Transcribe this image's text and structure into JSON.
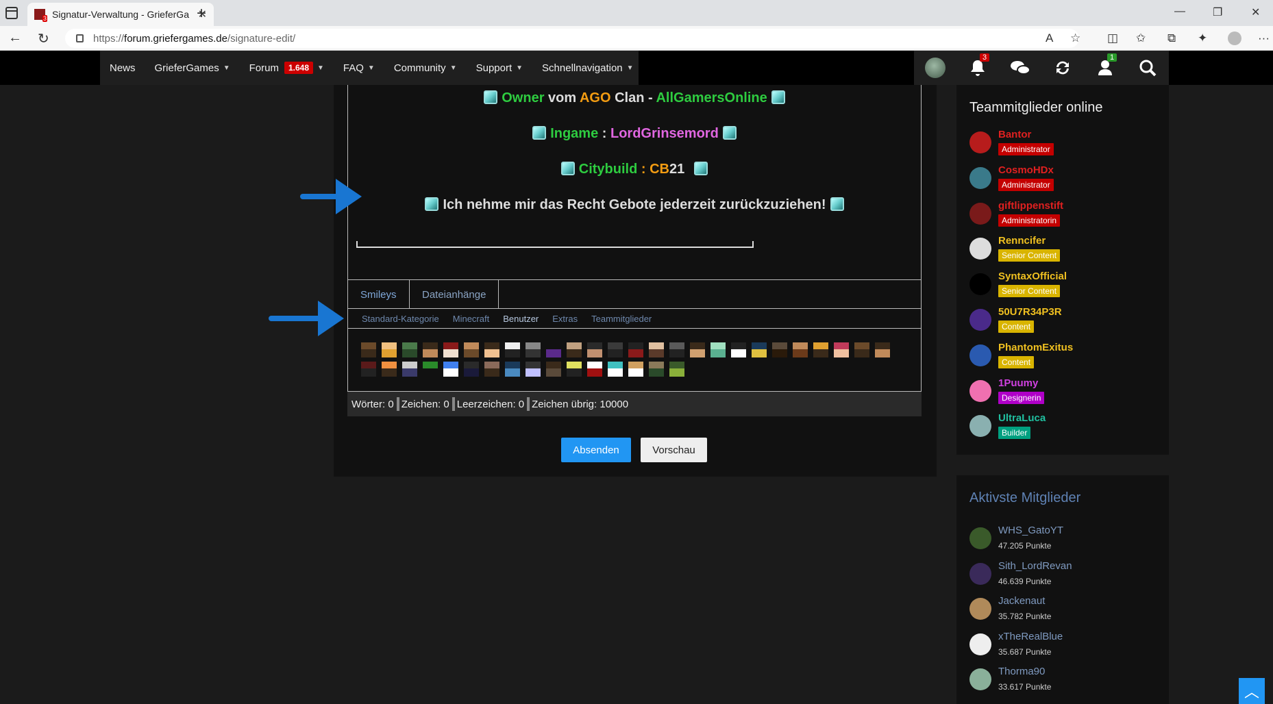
{
  "browser": {
    "tab_title": "Signatur-Verwaltung - GrieferGa",
    "url_protocol": "https://",
    "url_host": "forum.griefergames.de",
    "url_path": "/signature-edit/"
  },
  "nav": {
    "items": [
      {
        "label": "News",
        "has_chevron": false
      },
      {
        "label": "GrieferGames",
        "has_chevron": true
      },
      {
        "label": "Forum",
        "has_chevron": true,
        "badge": "1.648"
      },
      {
        "label": "FAQ",
        "has_chevron": true
      },
      {
        "label": "Community",
        "has_chevron": true
      },
      {
        "label": "Support",
        "has_chevron": true
      },
      {
        "label": "Schnellnavigation",
        "has_chevron": true
      }
    ],
    "notifications_count": "3",
    "friend_requests_count": "1"
  },
  "signature": {
    "line1": {
      "prefix_green": "Owner",
      "mid1": " vom ",
      "orange": "AGO",
      "mid2": " Clan - ",
      "green2": "AllGamersOnline"
    },
    "line2": {
      "green": "Ingame",
      "mid": " : ",
      "magenta": "LordGrinsemord"
    },
    "line3": {
      "green": "Citybuild",
      "mid": " : ",
      "orange": "CB",
      "white": "21"
    },
    "line4": "Ich nehme mir das Recht Gebote jederzeit zurückzuziehen!"
  },
  "editor": {
    "tabs": [
      "Smileys",
      "Dateianhänge"
    ],
    "categories": [
      "Standard-Kategorie",
      "Minecraft",
      "Benutzer",
      "Extras",
      "Teammitglieder"
    ],
    "selected_category": "Benutzer",
    "stats": {
      "words": "Wörter: 0",
      "chars": "Zeichen: 0",
      "spaces": "Leerzeichen: 0",
      "remaining": "Zeichen übrig: 10000"
    },
    "submit_label": "Absenden",
    "preview_label": "Vorschau"
  },
  "sidebar": {
    "team_title": "Teammitglieder online",
    "team": [
      {
        "name": "Bantor",
        "rank": "Administrator",
        "name_color": "#e02020",
        "rank_color": "#c40000"
      },
      {
        "name": "CosmoHDx",
        "rank": "Administrator",
        "name_color": "#e02020",
        "rank_color": "#c40000"
      },
      {
        "name": "giftlippenstift",
        "rank": "Administratorin",
        "name_color": "#e02020",
        "rank_color": "#c40000"
      },
      {
        "name": "Renncifer",
        "rank": "Senior Content",
        "name_color": "#f0c020",
        "rank_color": "#d9b400"
      },
      {
        "name": "SyntaxOfficial",
        "rank": "Senior Content",
        "name_color": "#f0c020",
        "rank_color": "#d9b400"
      },
      {
        "name": "50U7R34P3R",
        "rank": "Content",
        "name_color": "#f0c020",
        "rank_color": "#d9b400"
      },
      {
        "name": "PhantomExitus",
        "rank": "Content",
        "name_color": "#f0c020",
        "rank_color": "#d9b400"
      },
      {
        "name": "1Puumy",
        "rank": "Designerin",
        "name_color": "#d040e0",
        "rank_color": "#b000c8"
      },
      {
        "name": "UltraLuca",
        "rank": "Builder",
        "name_color": "#20c0a0",
        "rank_color": "#00a080"
      }
    ],
    "active_title": "Aktivste Mitglieder",
    "active": [
      {
        "name": "WHS_GatoYT",
        "points": "47.205 Punkte"
      },
      {
        "name": "Sith_LordRevan",
        "points": "46.639 Punkte"
      },
      {
        "name": "Jackenaut",
        "points": "35.782 Punkte"
      },
      {
        "name": "xTheRealBlue",
        "points": "35.687 Punkte"
      },
      {
        "name": "Thorma90",
        "points": "33.617 Punkte"
      }
    ]
  },
  "colors": {
    "accent": "#2196f3",
    "arrow": "#1976d2"
  }
}
